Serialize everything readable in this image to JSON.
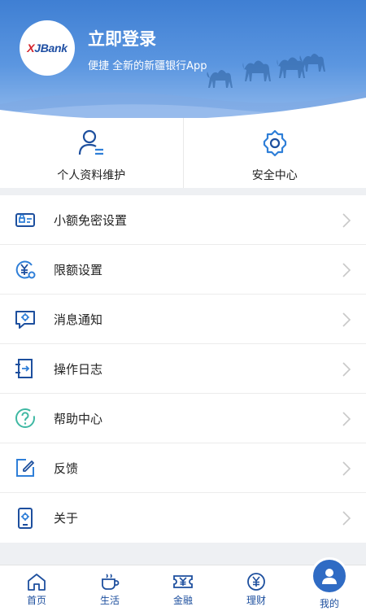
{
  "header": {
    "logo_text_x": "X",
    "logo_text_rest": "JBank",
    "login_title": "立即登录",
    "login_subtitle": "便捷  全新的新疆银行App"
  },
  "quick_actions": [
    {
      "label": "个人资料维护",
      "icon": "user-edit-icon"
    },
    {
      "label": "安全中心",
      "icon": "gear-icon"
    }
  ],
  "menu": [
    {
      "label": "小额免密设置",
      "icon": "card-lock-icon"
    },
    {
      "label": "限额设置",
      "icon": "yuan-gear-icon"
    },
    {
      "label": "消息通知",
      "icon": "message-gear-icon"
    },
    {
      "label": "操作日志",
      "icon": "log-arrow-icon"
    },
    {
      "label": "帮助中心",
      "icon": "help-icon"
    },
    {
      "label": "反馈",
      "icon": "feedback-edit-icon"
    },
    {
      "label": "关于",
      "icon": "phone-gear-icon"
    }
  ],
  "tabs": [
    {
      "label": "首页",
      "icon": "home-icon"
    },
    {
      "label": "生活",
      "icon": "cup-icon"
    },
    {
      "label": "金融",
      "icon": "yuan-ticket-icon"
    },
    {
      "label": "理财",
      "icon": "yuan-circle-icon"
    },
    {
      "label": "我的",
      "icon": "user-icon",
      "active": true
    }
  ],
  "colors": {
    "brand_blue": "#2f6bc4",
    "icon_blue": "#1d4f9e",
    "help_green": "#3fb8a3",
    "header_blue": "#3f7fd3"
  }
}
